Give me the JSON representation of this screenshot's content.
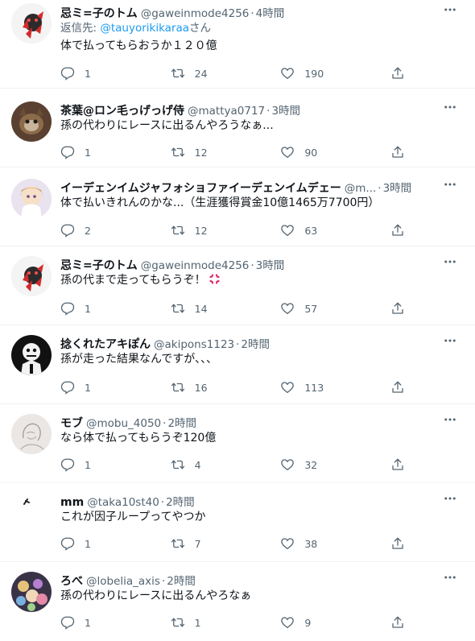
{
  "tweets": [
    {
      "name": "忌ミ=子のトム",
      "handle": "@gaweinmode4256",
      "time": "4時間",
      "replying_prefix": "返信先: ",
      "replying_to": "@tauyorikikaraa",
      "replying_suffix": "さん",
      "text": "体で払ってもらおうか１２０億",
      "replies": "1",
      "retweets": "24",
      "likes": "190",
      "avatar": "red-creature"
    },
    {
      "name": "茶葉@ロン毛っげっげ侍",
      "handle": "@mattya0717",
      "time": "3時間",
      "text": "孫の代わりにレースに出るんやろうなぁ...",
      "replies": "1",
      "retweets": "12",
      "likes": "90",
      "avatar": "cat-photo"
    },
    {
      "name": "イーデェンイムジャフォショファイーデェンイムデェー",
      "handle": "@m...",
      "time": "3時間",
      "text": "体で払いきれんのかな...（生涯獲得賞金10億1465万7700円）",
      "replies": "2",
      "retweets": "12",
      "likes": "63",
      "avatar": "anime-girl"
    },
    {
      "name": "忌ミ=子のトム",
      "handle": "@gaweinmode4256",
      "time": "3時間",
      "text": "孫の代まで走ってもらうぞ！",
      "replies": "1",
      "retweets": "14",
      "likes": "57",
      "avatar": "red-creature",
      "emoji": "anger-symbol"
    },
    {
      "name": "捻くれたアキぽん",
      "handle": "@akipons1123",
      "time": "2時間",
      "text": "孫が走った結果なんですが、、、",
      "replies": "1",
      "retweets": "16",
      "likes": "113",
      "avatar": "monochrome-character"
    },
    {
      "name": "モブ",
      "handle": "@mobu_4050",
      "time": "2時間",
      "text": "なら体で払ってもらうぞ120億",
      "replies": "1",
      "retweets": "4",
      "likes": "32",
      "avatar": "sketch-drawing"
    },
    {
      "name": "mm",
      "handle": "@taka10st40",
      "time": "2時間",
      "text": "これが因子ループってやつか",
      "replies": "1",
      "retweets": "7",
      "likes": "38",
      "avatar": "minimal-mark"
    },
    {
      "name": "ろべ",
      "handle": "@lobelia_axis",
      "time": "2時間",
      "text": "孫の代わりにレースに出るんやろなぁ",
      "replies": "1",
      "retweets": "1",
      "likes": "9",
      "avatar": "figure-collection"
    }
  ],
  "colors": {
    "text_primary": "#0f1419",
    "text_secondary": "#536471",
    "link": "#1d9bf0",
    "divider": "#eff3f4"
  },
  "icons": {
    "more": "more-dots-icon",
    "reply": "reply-icon",
    "retweet": "retweet-icon",
    "like": "heart-icon",
    "share": "share-icon"
  }
}
